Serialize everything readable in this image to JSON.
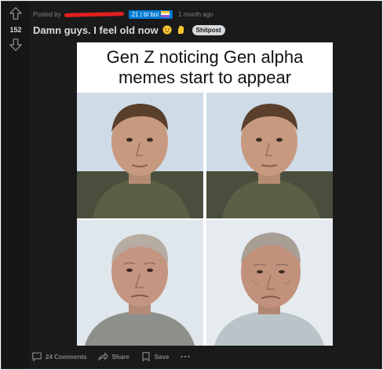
{
  "post": {
    "score": "152",
    "posted_by_label": "Posted by",
    "user_flair": "21 | bl boi",
    "time_ago": "1 month ago",
    "title": "Damn guys. I feel old now",
    "tag": "Shitpost"
  },
  "meme": {
    "caption_line1": "Gen Z noticing Gen alpha",
    "caption_line2": "memes start to appear",
    "panels": [
      "young-face-left",
      "young-face-right",
      "old-face-left",
      "old-face-right"
    ]
  },
  "actions": {
    "comments": "24 Comments",
    "share": "Share",
    "save": "Save"
  },
  "icons": [
    "upvote-icon",
    "downvote-icon",
    "comment-icon",
    "share-icon",
    "save-icon",
    "more-icon"
  ],
  "colors": {
    "background": "#1a1a1b",
    "text": "#d7dadc",
    "muted": "#818384",
    "flair": "#0079d3",
    "redaction": "#e0201f"
  }
}
